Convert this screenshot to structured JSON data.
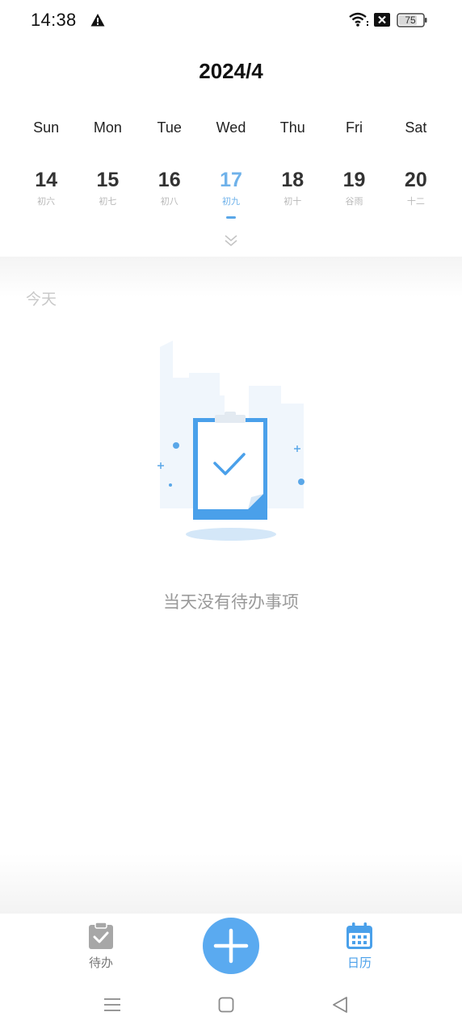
{
  "status_bar": {
    "time": "14:38",
    "battery": "75",
    "icons": [
      "alert-icon",
      "wifi-icon",
      "no-sim-icon",
      "battery-icon"
    ]
  },
  "calendar": {
    "month_title": "2024/4",
    "weekdays": [
      "Sun",
      "Mon",
      "Tue",
      "Wed",
      "Thu",
      "Fri",
      "Sat"
    ],
    "days": [
      {
        "num": "14",
        "lunar": "初六"
      },
      {
        "num": "15",
        "lunar": "初七"
      },
      {
        "num": "16",
        "lunar": "初八"
      },
      {
        "num": "17",
        "lunar": "初九",
        "selected": true
      },
      {
        "num": "18",
        "lunar": "初十"
      },
      {
        "num": "19",
        "lunar": "谷雨"
      },
      {
        "num": "20",
        "lunar": "十二"
      }
    ],
    "accent_color": "#5aa7e8"
  },
  "content": {
    "section_label": "今天",
    "empty_message": "当天没有待办事项"
  },
  "bottom_nav": {
    "todo_label": "待办",
    "calendar_label": "日历",
    "active": "calendar",
    "fab_icon": "plus-icon",
    "fab_color": "#5aaaf0"
  },
  "system_nav": {
    "icons": [
      "menu-icon",
      "home-icon",
      "back-icon"
    ]
  }
}
